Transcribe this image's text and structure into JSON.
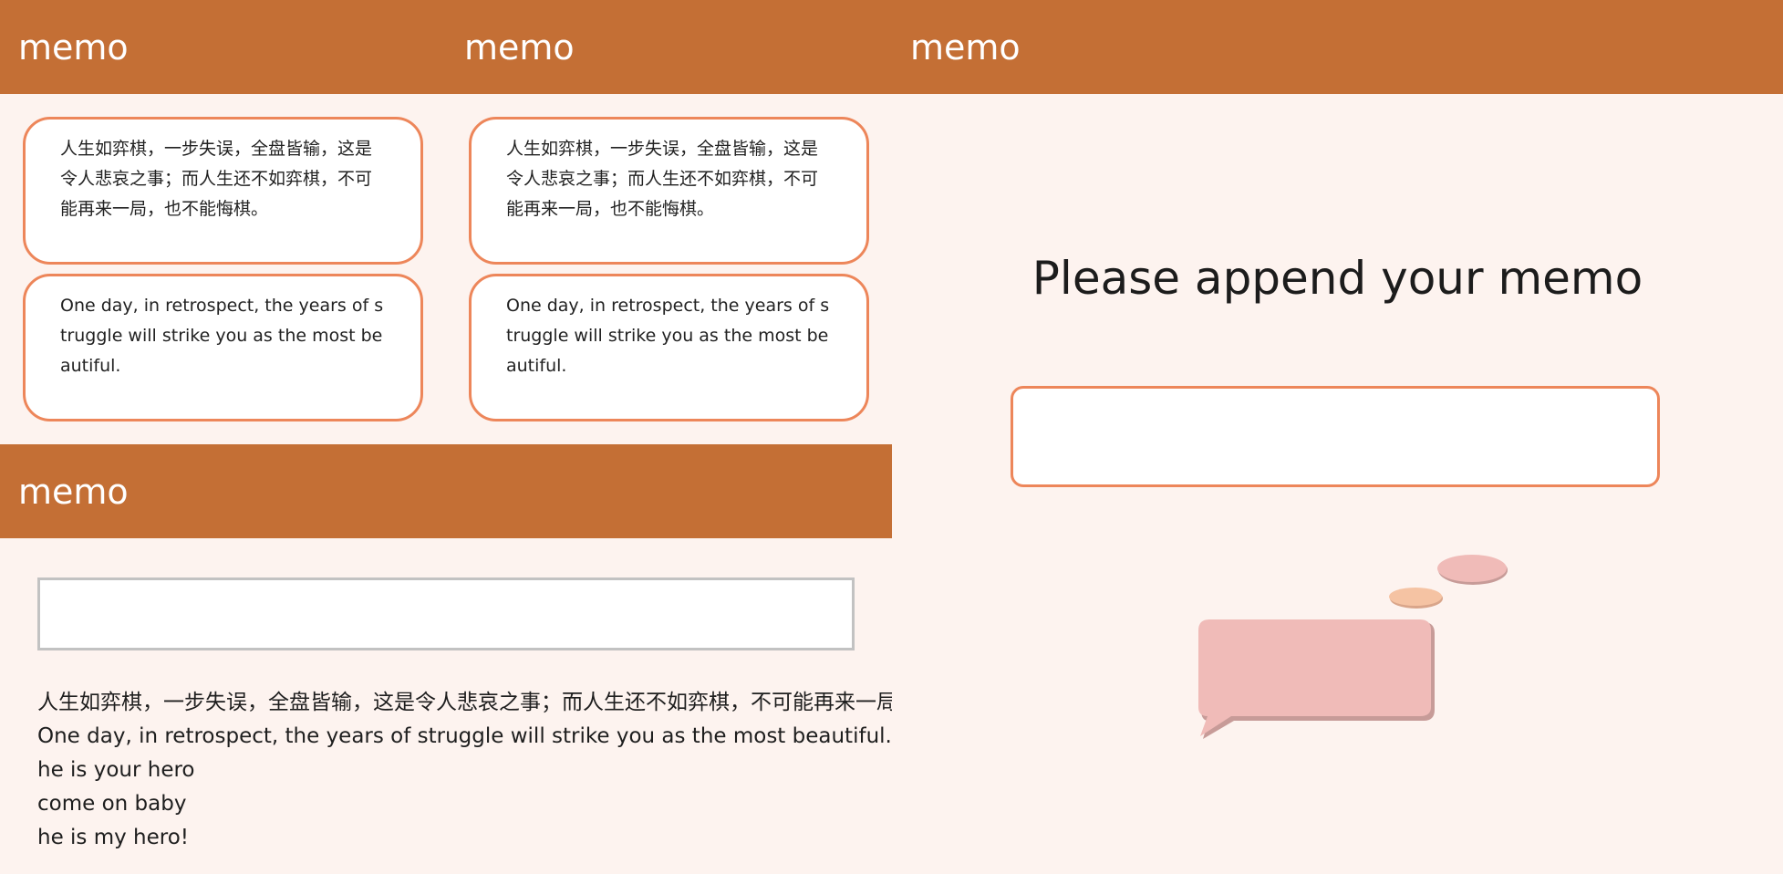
{
  "colors": {
    "header_bg": "#c46f35",
    "page_bg": "#fdf3ef",
    "card_border": "#ed865a",
    "bubble": "#f0bbb8",
    "bubble_shadow": "#c79b98",
    "dot_small": "#f5c3a3"
  },
  "panel_a": {
    "header_title": "memo",
    "cards": [
      {
        "text": "人生如弈棋，一步失误，全盘皆输，这是令人悲哀之事；而人生还不如弈棋，不可能再来一局，也不能悔棋。"
      },
      {
        "text": "One day, in retrospect, the years of struggle will strike you as the most beautiful."
      }
    ]
  },
  "panel_b": {
    "header_title": "memo",
    "cards": [
      {
        "text": "人生如弈棋，一步失误，全盘皆输，这是令人悲哀之事；而人生还不如弈棋，不可能再来一局，也不能悔棋。"
      },
      {
        "text": "One day, in retrospect, the years of struggle will strike you as the most beautiful."
      }
    ]
  },
  "panel_c": {
    "header_title": "memo",
    "input_value": "",
    "memos": [
      "人生如弈棋，一步失误，全盘皆输，这是令人悲哀之事；而人生还不如弈棋，不可能再来一局，也不能悔棋。",
      "One day, in retrospect, the years of struggle will strike you as the most beautiful.",
      "he is your hero",
      "come on baby",
      "he is my hero!"
    ]
  },
  "panel_d": {
    "header_title": "memo",
    "heading": "Please append your memo",
    "input_value": "",
    "illustration_icon": "speech-bubble-icon"
  }
}
